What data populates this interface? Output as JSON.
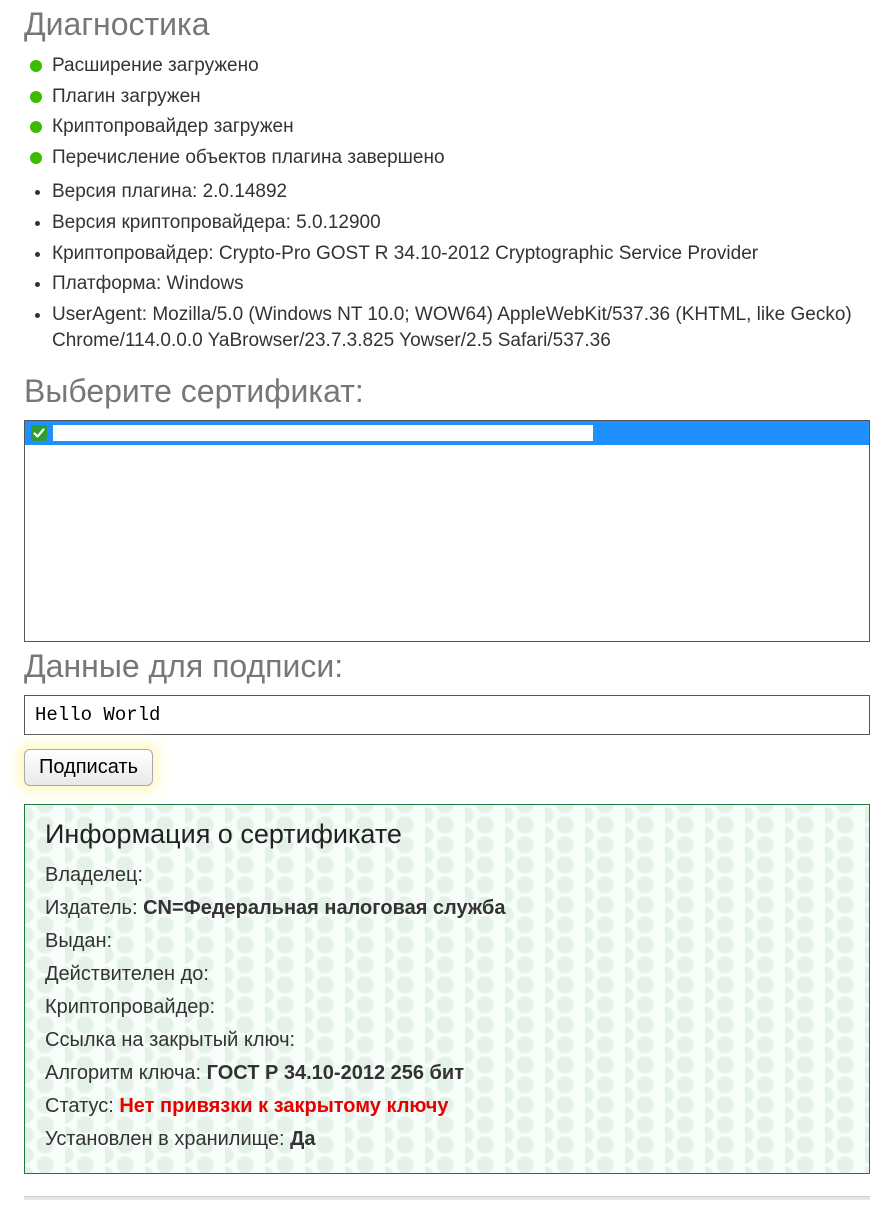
{
  "sections": {
    "diagnostics_title": "Диагностика",
    "select_cert_title": "Выберите сертификат:",
    "sign_data_title": "Данные для подписи:"
  },
  "status_items": [
    "Расширение загружено",
    "Плагин загружен",
    "Криптопровайдер загружен",
    "Перечисление объектов плагина завершено"
  ],
  "info_items": [
    "Версия плагина: 2.0.14892",
    "Версия криптопровайдера: 5.0.12900",
    "Криптопровайдер: Crypto-Pro GOST R 34.10-2012 Cryptographic Service Provider",
    "Платформа: Windows",
    "UserAgent: Mozilla/5.0 (Windows NT 10.0; WOW64) AppleWebKit/537.36 (KHTML, like Gecko) Chrome/114.0.0.0 YaBrowser/23.7.3.825 Yowser/2.5 Safari/537.36"
  ],
  "sign_input_value": "Hello World",
  "sign_button_label": "Подписать",
  "cert_info": {
    "title": "Информация о сертификате",
    "owner_label": "Владелец:",
    "owner_value": "",
    "issuer_label": "Издатель:",
    "issuer_value": "CN=Федеральная налоговая служба",
    "issued_label": "Выдан:",
    "issued_value": "",
    "valid_to_label": "Действителен до:",
    "valid_to_value": "",
    "csp_label": "Криптопровайдер:",
    "csp_value": "",
    "privkey_label": "Ссылка на закрытый ключ:",
    "privkey_value": "",
    "algo_label": "Алгоритм ключа:",
    "algo_value": "ГОСТ Р 34.10-2012 256 бит",
    "status_label": "Статус:",
    "status_value": "Нет привязки к закрытому ключу",
    "store_label": "Установлен в хранилище:",
    "store_value": "Да"
  }
}
